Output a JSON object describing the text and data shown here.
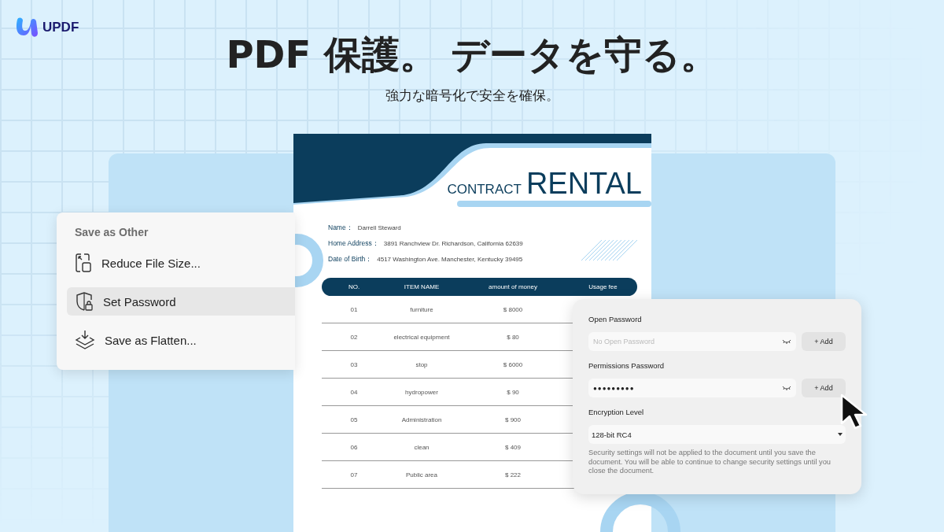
{
  "brand": {
    "name": "UPDF"
  },
  "headline": "PDF 保護。 データを守る。",
  "subheadline": "強力な暗号化で安全を確保。",
  "document": {
    "title_small": "CONTRACT",
    "title_large": "RENTAL",
    "fields": [
      {
        "label": "Name：",
        "value": "Darrell Steward"
      },
      {
        "label": "Home Address：",
        "value": "3891 Ranchview Dr. Richardson, California 62639"
      },
      {
        "label": "Date of Birth：",
        "value": "4517 Washington Ave. Manchester, Kentucky 39495"
      }
    ],
    "table": {
      "columns": [
        "NO.",
        "ITEM NAME",
        "amount of money",
        "Usage fee"
      ],
      "rows": [
        [
          "01",
          "furniture",
          "$ 8000"
        ],
        [
          "02",
          "electrical equipment",
          "$ 80"
        ],
        [
          "03",
          "stop",
          "$ 6000"
        ],
        [
          "04",
          "hydropower",
          "$ 90"
        ],
        [
          "05",
          "Administration",
          "$ 900"
        ],
        [
          "06",
          "clean",
          "$ 409"
        ],
        [
          "07",
          "Public area",
          "$ 222"
        ]
      ]
    }
  },
  "menu": {
    "title": "Save as Other",
    "items": [
      {
        "label": "Reduce File Size...",
        "kind": "reduce",
        "selected": false
      },
      {
        "label": "Set Password",
        "kind": "password",
        "selected": true
      },
      {
        "label": "Save as Flatten...",
        "kind": "flatten",
        "selected": false
      }
    ]
  },
  "dialog": {
    "open_password": {
      "label": "Open Password",
      "placeholder": "No Open Password",
      "button": "+ Add"
    },
    "permissions_password": {
      "label": "Permissions Password",
      "masked_value": "●●●●●●●●●",
      "button": "+ Add"
    },
    "encryption_level": {
      "label": "Encryption Level",
      "value": "128-bit RC4"
    },
    "note": "Security settings will not be applied to the document until you save the document. You will be able to continue to change security settings until you close the document."
  }
}
